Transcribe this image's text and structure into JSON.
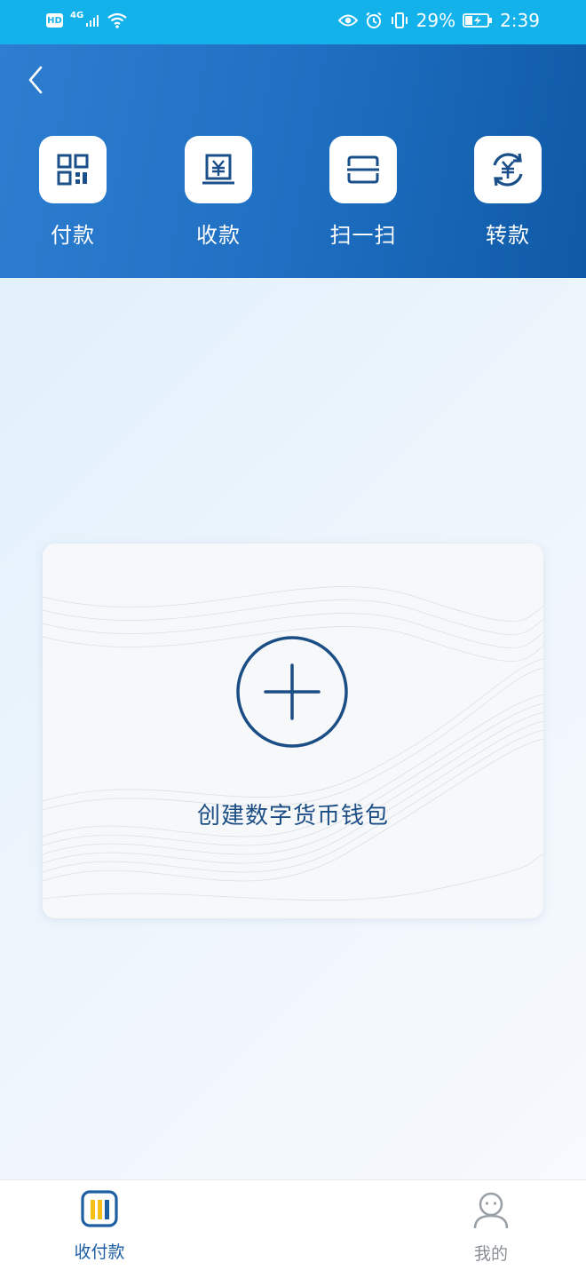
{
  "status_bar": {
    "hd": "HD",
    "network": "4G",
    "battery_percent": "29%",
    "time": "2:39",
    "icons": [
      "wifi-icon",
      "eye-icon",
      "alarm-icon",
      "vibrate-icon",
      "battery-charging-icon"
    ]
  },
  "header": {
    "actions": [
      {
        "label": "付款",
        "icon": "qr-code-icon"
      },
      {
        "label": "收款",
        "icon": "yuan-receipt-icon"
      },
      {
        "label": "扫一扫",
        "icon": "scan-icon"
      },
      {
        "label": "转款",
        "icon": "yuan-transfer-icon"
      }
    ]
  },
  "wallet_card": {
    "label": "创建数字货币钱包",
    "icon": "plus-circle-icon"
  },
  "bottom_nav": {
    "items": [
      {
        "label": "收付款",
        "icon": "wallet-card-icon",
        "active": true
      },
      {
        "label": "我的",
        "icon": "user-icon",
        "active": false
      }
    ]
  },
  "colors": {
    "status_bar": "#13b2ea",
    "header": "#1f6fc2",
    "accent": "#1e5fa3",
    "nav_highlight": "#f5c016"
  }
}
